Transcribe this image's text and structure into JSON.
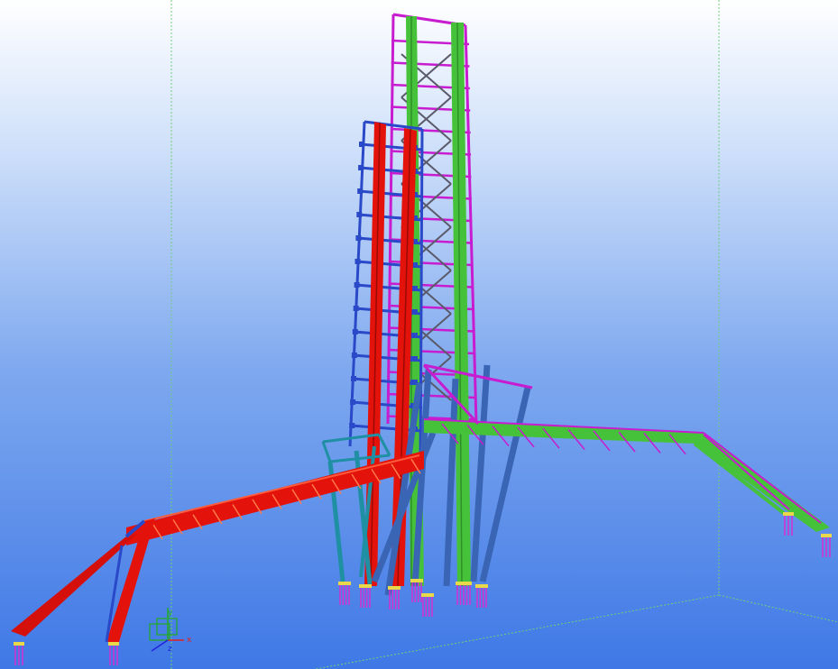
{
  "viewport": {
    "background_top": "#ffffff",
    "background_bottom": "#3f78e6"
  },
  "colors": {
    "primary_red": "#e3120b",
    "secondary_red": "#d50f0a",
    "blue_frame": "#2a49c9",
    "steel_blue": "#3a64b4",
    "teal": "#1f8fa4",
    "green": "#46c23a",
    "magenta": "#c71ccf",
    "gray_brace": "#5a5a6a",
    "grid_line": "#6fd07a",
    "foundation": "#d62fd0",
    "axis_x": "#e22222",
    "axis_y": "#22aa22",
    "axis_z": "#2222dd"
  },
  "model": {
    "description_icon": "3d-steel-conveyor-structure"
  },
  "axes": {
    "x_label": "x",
    "y_label": "y",
    "z_label": "z"
  }
}
